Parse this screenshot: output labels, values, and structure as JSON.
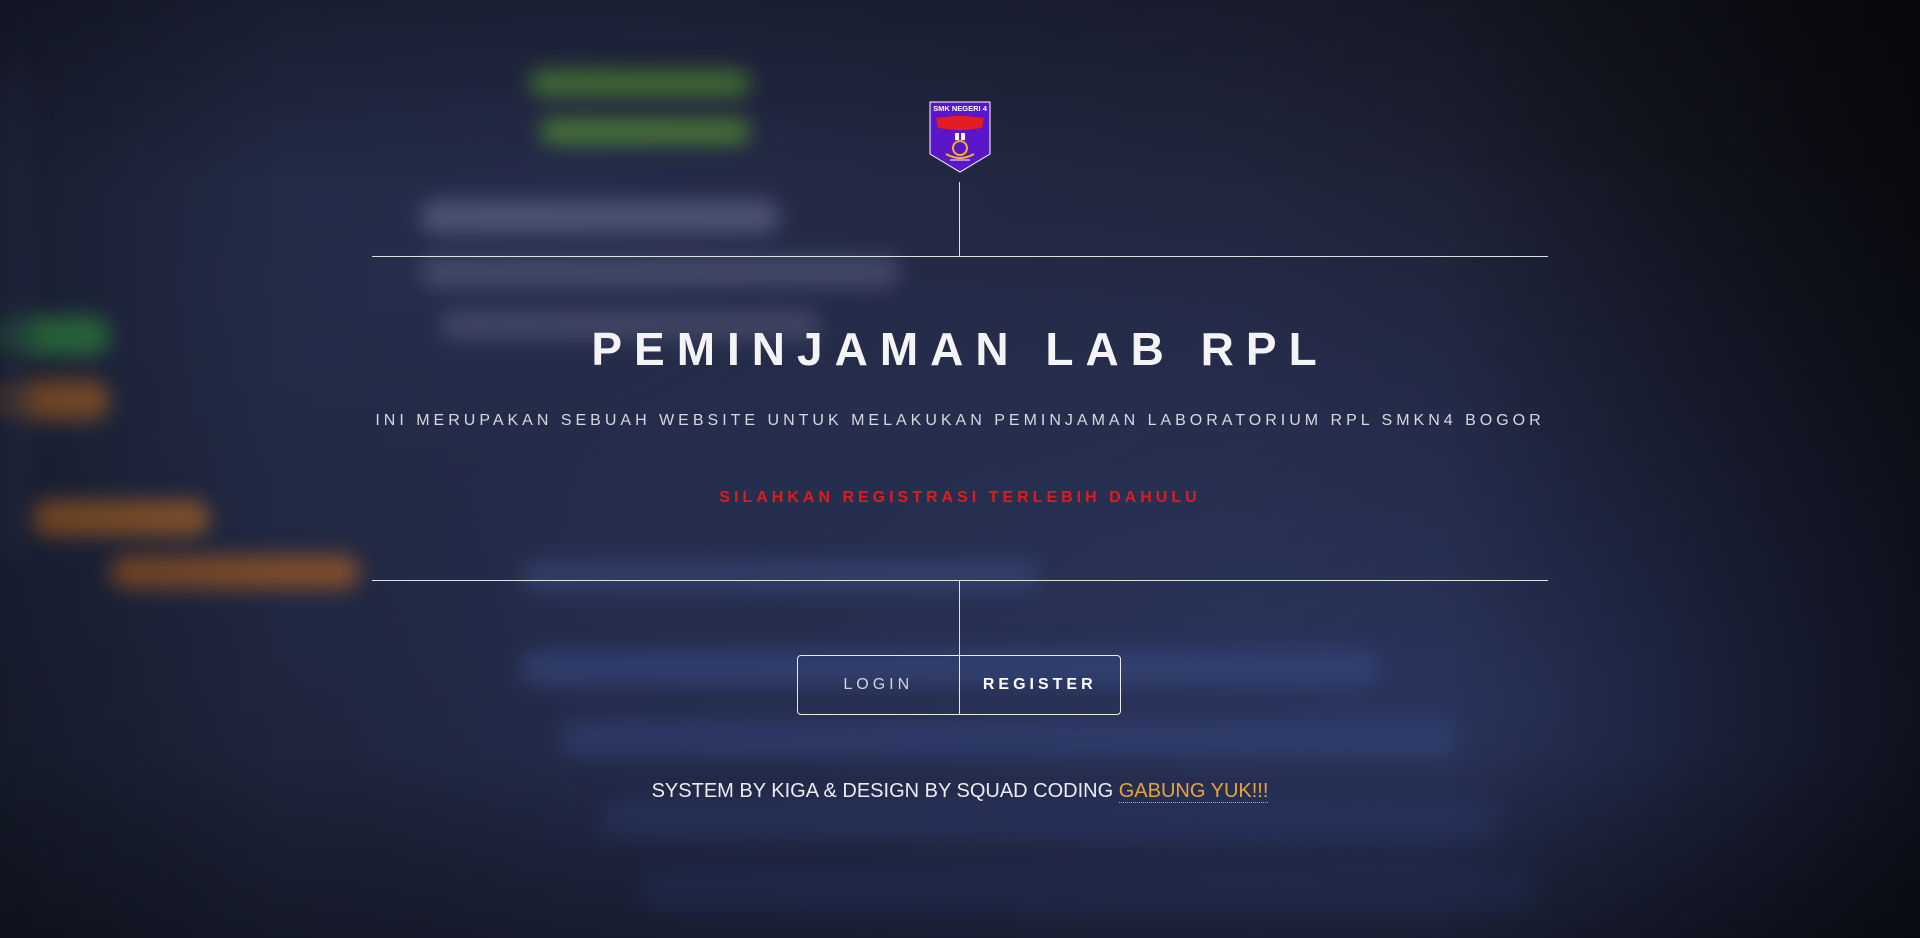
{
  "logo": {
    "text": "SMK NEGERI 4",
    "colors": {
      "shield": "#5a17c9",
      "red": "#e31b23",
      "gold": "#f2b21b"
    }
  },
  "hero": {
    "title": "PEMINJAMAN LAB RPL",
    "subtitle": "INI MERUPAKAN SEBUAH WEBSITE UNTUK MELAKUKAN PEMINJAMAN LABORATORIUM RPL SMKN4 BOGOR",
    "warning": "SILAHKAN REGISTRASI TERLEBIH DAHULU"
  },
  "actions": {
    "login_label": "LOGIN",
    "register_label": "REGISTER"
  },
  "footer": {
    "text": "SYSTEM BY KIGA & DESIGN BY SQUAD CODING",
    "link_label": "GABUNG YUK!!!"
  },
  "colors": {
    "warning": "#e01b1b",
    "link": "#e8a33a",
    "line": "#ffffff"
  }
}
